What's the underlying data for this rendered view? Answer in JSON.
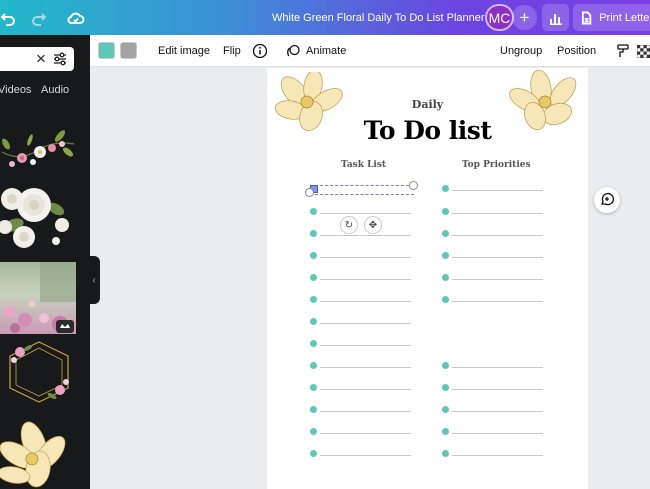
{
  "header": {
    "doc_title": "White Green Floral Daily To Do List Planner",
    "avatar_initials": "MC",
    "add_label": "+",
    "print_label": "Print Letter"
  },
  "sidebar": {
    "search_clear": "×",
    "tabs": [
      "Videos",
      "Audio"
    ],
    "collapse_glyph": "‹"
  },
  "toolbar": {
    "swatch_colors": [
      "#5fc7b7",
      "#a4a4a4"
    ],
    "edit_image": "Edit image",
    "flip": "Flip",
    "animate": "Animate",
    "ungroup": "Ungroup",
    "position": "Position"
  },
  "page": {
    "subtitle": "Daily",
    "title": "To Do list",
    "left_heading": "Task List",
    "right_heading": "Top Priorities",
    "accent_color": "#5fc7b7"
  }
}
